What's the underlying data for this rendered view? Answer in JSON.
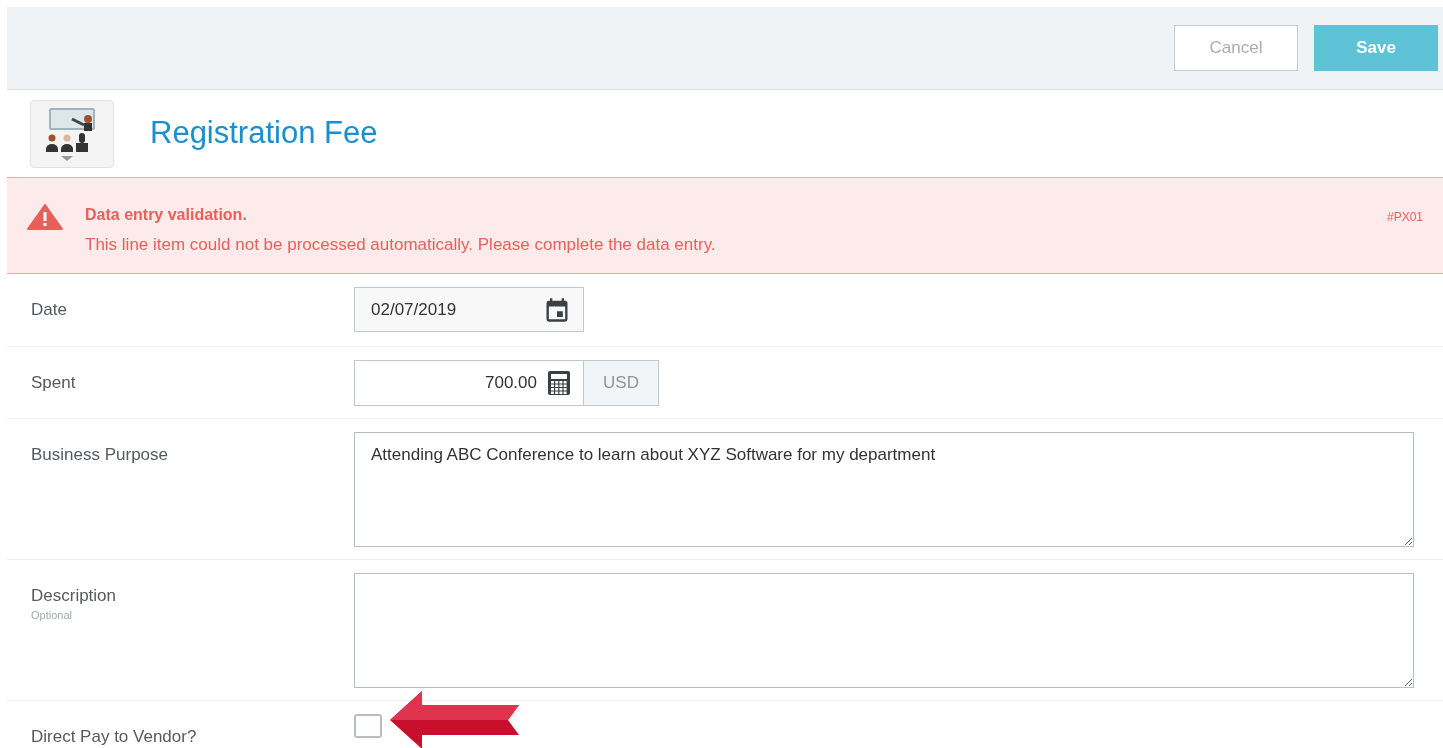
{
  "toolbar": {
    "buttons": [
      {
        "label": "Cancel",
        "kind": "secondary"
      },
      {
        "label": "Save",
        "kind": "primary"
      }
    ]
  },
  "header": {
    "title": "Registration Fee"
  },
  "alert": {
    "title": "Data entry validation.",
    "message": "This line item could not be processed automatically. Please complete the data entry.",
    "code": "#PX01"
  },
  "fields": [
    {
      "kind": "date",
      "label": "Date",
      "value": "02/07/2019"
    },
    {
      "kind": "amount",
      "label": "Spent",
      "value": "700.00",
      "currency": "USD"
    },
    {
      "kind": "textarea",
      "label": "Business Purpose",
      "value": "Attending ABC Conference to learn about XYZ Software for my department"
    },
    {
      "kind": "textarea",
      "label": "Description",
      "hint": "Optional"
    },
    {
      "kind": "checkbox",
      "label": "Direct Pay to Vendor?",
      "checked": false
    }
  ]
}
